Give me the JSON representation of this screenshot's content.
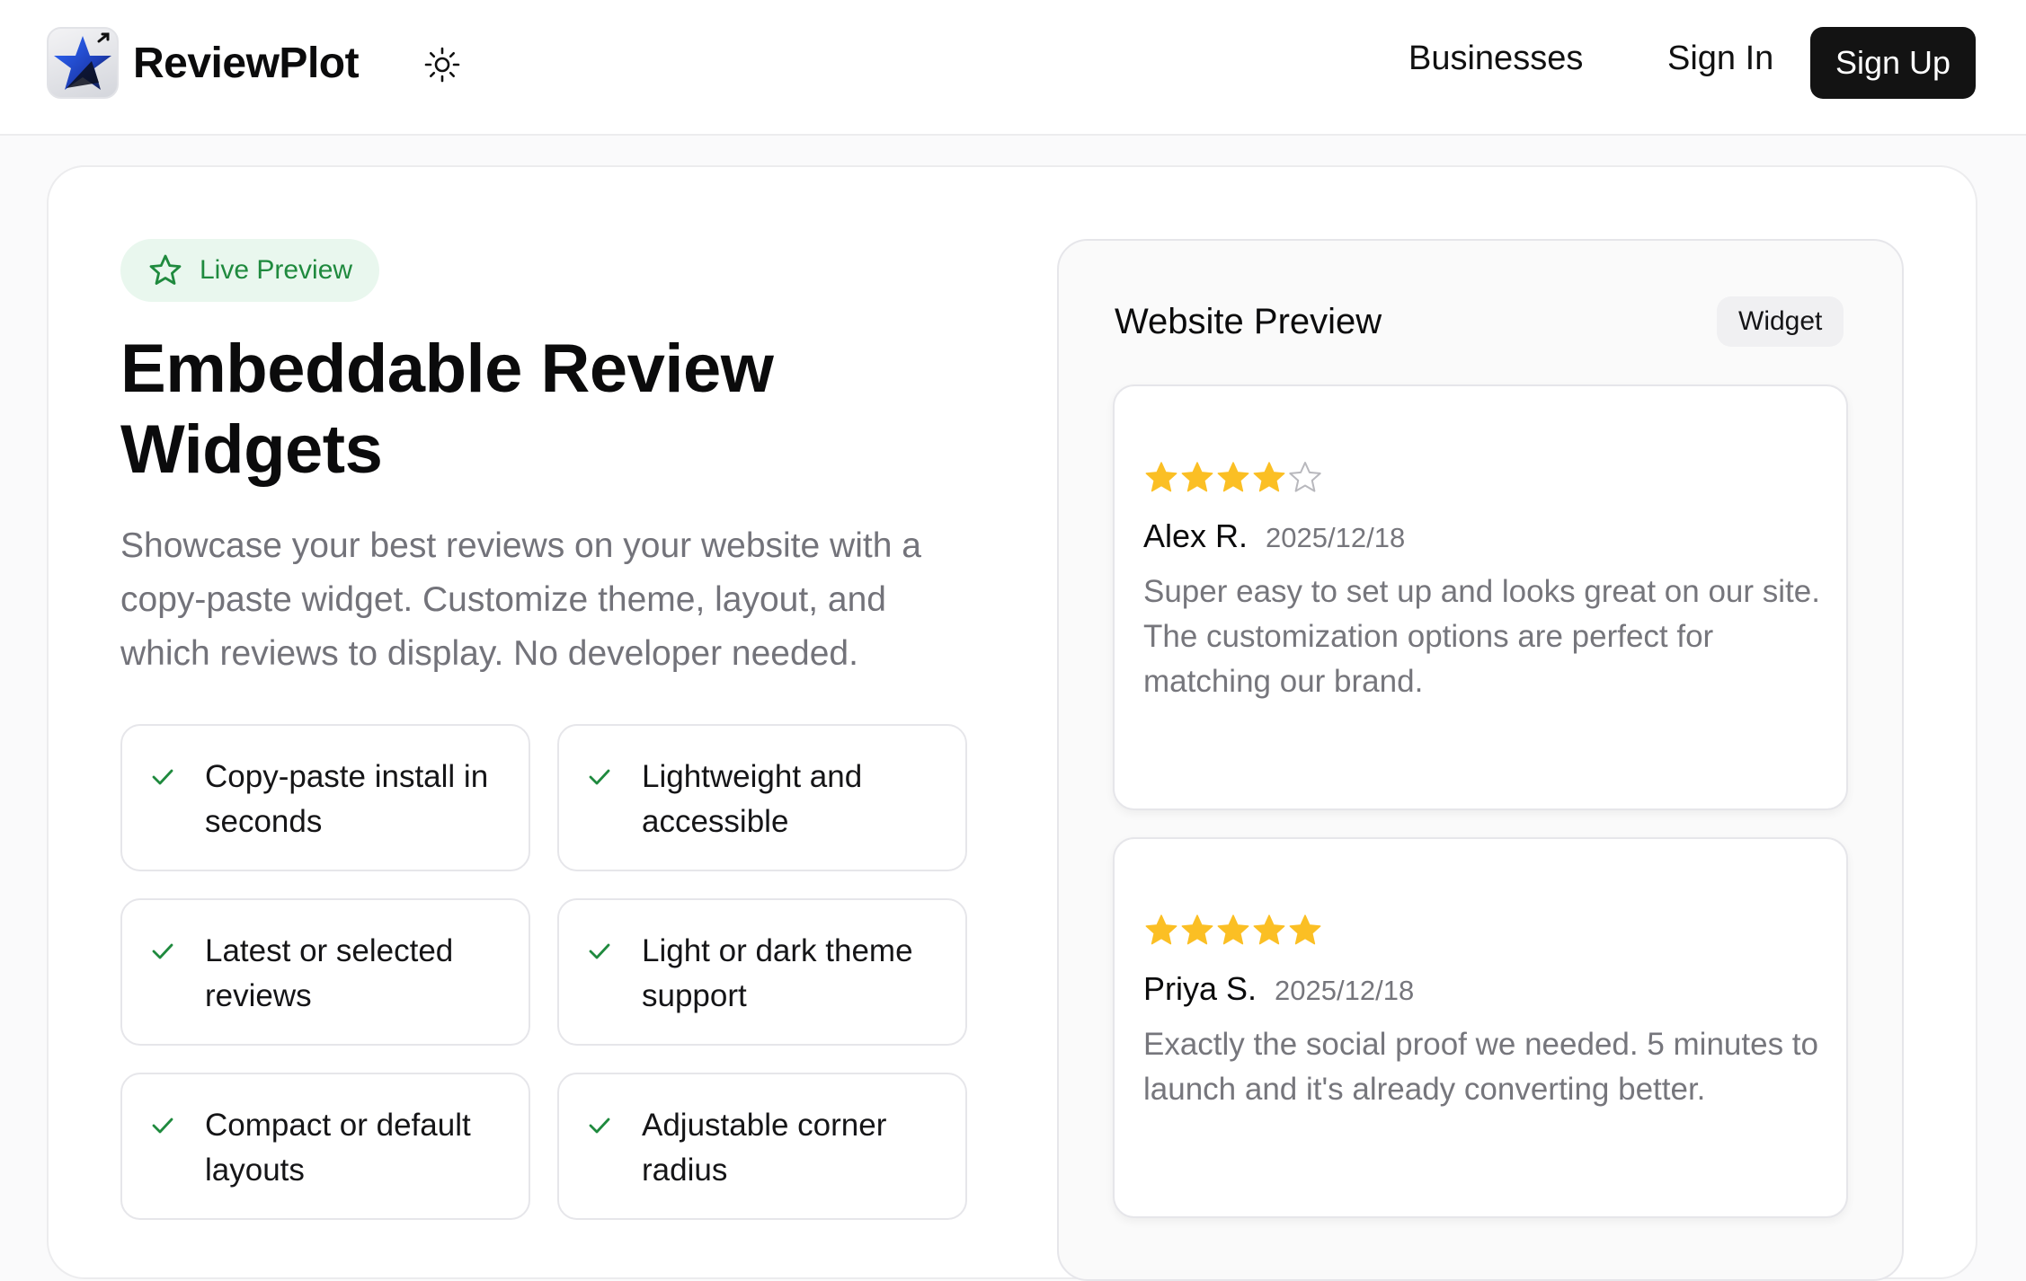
{
  "header": {
    "brand": "ReviewPlot",
    "nav": {
      "businesses": "Businesses",
      "sign_in": "Sign In",
      "sign_up": "Sign Up"
    },
    "icons": {
      "logo": "star-logo-icon",
      "theme": "sun-icon"
    }
  },
  "hero": {
    "pill_label": "Live Preview",
    "pill_icon": "star-outline-icon",
    "title": "Embeddable Review Widgets",
    "subtitle": "Showcase your best reviews on your website with a copy-paste widget. Customize theme, layout, and which reviews to display. No developer needed.",
    "features": [
      "Copy-paste install in seconds",
      "Lightweight and accessible",
      "Latest or selected reviews",
      "Light or dark theme support",
      "Compact or default layouts",
      "Adjustable corner radius"
    ]
  },
  "preview": {
    "title": "Website Preview",
    "tag": "Widget",
    "reviews": [
      {
        "rating": 4,
        "max_rating": 5,
        "name": "Alex R.",
        "date": "2025/12/18",
        "text": "Super easy to set up and looks great on our site. The customization options are perfect for matching our brand."
      },
      {
        "rating": 5,
        "max_rating": 5,
        "name": "Priya S.",
        "date": "2025/12/18",
        "text": "Exactly the social proof we needed. 5 minutes to launch and it's already converting better."
      }
    ]
  },
  "colors": {
    "accent_green": "#1f8a3e",
    "pill_bg": "#e9f7ee",
    "star_fill": "#fbbf24",
    "signup_bg": "#131313"
  }
}
